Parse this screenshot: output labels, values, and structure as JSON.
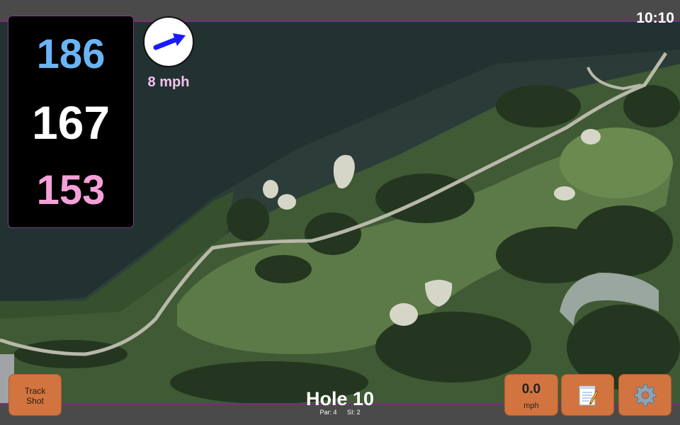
{
  "status": {
    "time": "10:10"
  },
  "distances": {
    "back": "186",
    "center": "167",
    "front": "153"
  },
  "wind": {
    "speed": "8 mph",
    "icon": "wind-direction-arrow-icon"
  },
  "hole": {
    "title": "Hole 10",
    "par": "Par: 4",
    "stroke_index": "SI: 2"
  },
  "buttons": {
    "track_shot": "Track Shot",
    "speed_value": "0.0",
    "speed_unit": "mph",
    "notes_icon": "notepad-icon",
    "settings_icon": "gear-icon"
  },
  "colors": {
    "back_distance": "#6ab4f5",
    "center_distance": "#ffffff",
    "front_distance": "#f5a0d8",
    "button": "#d27440",
    "accent_border": "#7a2f7a"
  }
}
